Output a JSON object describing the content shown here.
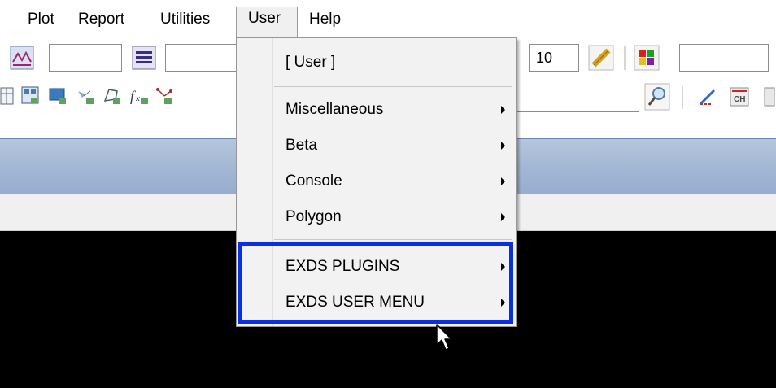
{
  "menubar": {
    "items": [
      "Plot",
      "Report",
      "Utilities",
      "User",
      "Help"
    ],
    "active": "User"
  },
  "toolbar": {
    "zoom_value": "10"
  },
  "user_menu": {
    "header": "[ User ]",
    "items": [
      {
        "label": "Miscellaneous",
        "submenu": true
      },
      {
        "label": "Beta",
        "submenu": true
      },
      {
        "label": "Console",
        "submenu": true
      },
      {
        "label": "Polygon",
        "submenu": true
      },
      {
        "label": "EXDS PLUGINS",
        "submenu": true
      },
      {
        "label": "EXDS USER MENU",
        "submenu": true
      }
    ]
  },
  "colors": {
    "highlight_border": "#0a2fe0",
    "canvas": "#000000",
    "band": "#a3b8d4"
  }
}
